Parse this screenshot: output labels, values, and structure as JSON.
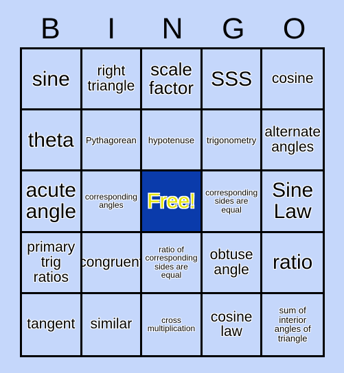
{
  "card": {
    "background_color": "#c5d7fb",
    "border_color": "#000000",
    "title_letters": [
      "B",
      "I",
      "N",
      "G",
      "O"
    ]
  },
  "header": {
    "b": "B",
    "i": "I",
    "n": "N",
    "g": "G",
    "o": "O"
  },
  "free_space": {
    "label": "Free!",
    "background_color": "#0a3bab",
    "text_color": "#e3e300"
  },
  "grid": {
    "rows": 5,
    "columns": 5,
    "cells": [
      {
        "text": "sine",
        "size": "xl",
        "free": false
      },
      {
        "text": "right triangle",
        "size": "md",
        "free": false
      },
      {
        "text": "scale factor",
        "size": "lg",
        "free": false
      },
      {
        "text": "SSS",
        "size": "xl",
        "free": false
      },
      {
        "text": "cosine",
        "size": "md",
        "free": false
      },
      {
        "text": "theta",
        "size": "xl",
        "free": false
      },
      {
        "text": "Pythagorean",
        "size": "sm",
        "free": false
      },
      {
        "text": "hypotenuse",
        "size": "sm",
        "free": false
      },
      {
        "text": "trigonometry",
        "size": "sm",
        "free": false
      },
      {
        "text": "alternate angles",
        "size": "md",
        "free": false
      },
      {
        "text": "acute angle",
        "size": "xl",
        "free": false
      },
      {
        "text": "corresponding angles",
        "size": "xs",
        "free": false
      },
      {
        "text": "Free!",
        "size": "xl",
        "free": true
      },
      {
        "text": "corresponding sides are equal",
        "size": "xs",
        "free": false
      },
      {
        "text": "Sine Law",
        "size": "xl",
        "free": false
      },
      {
        "text": "primary trig ratios",
        "size": "md",
        "free": false
      },
      {
        "text": "congruent",
        "size": "md",
        "free": false
      },
      {
        "text": "ratio of corresponding sides are equal",
        "size": "xs",
        "free": false
      },
      {
        "text": "obtuse angle",
        "size": "md",
        "free": false
      },
      {
        "text": "ratio",
        "size": "xl",
        "free": false
      },
      {
        "text": "tangent",
        "size": "md",
        "free": false
      },
      {
        "text": "similar",
        "size": "md",
        "free": false
      },
      {
        "text": "cross multiplication",
        "size": "xs",
        "free": false
      },
      {
        "text": "cosine law",
        "size": "md",
        "free": false
      },
      {
        "text": "sum of interior angles of triangle",
        "size": "sm",
        "free": false
      }
    ]
  }
}
